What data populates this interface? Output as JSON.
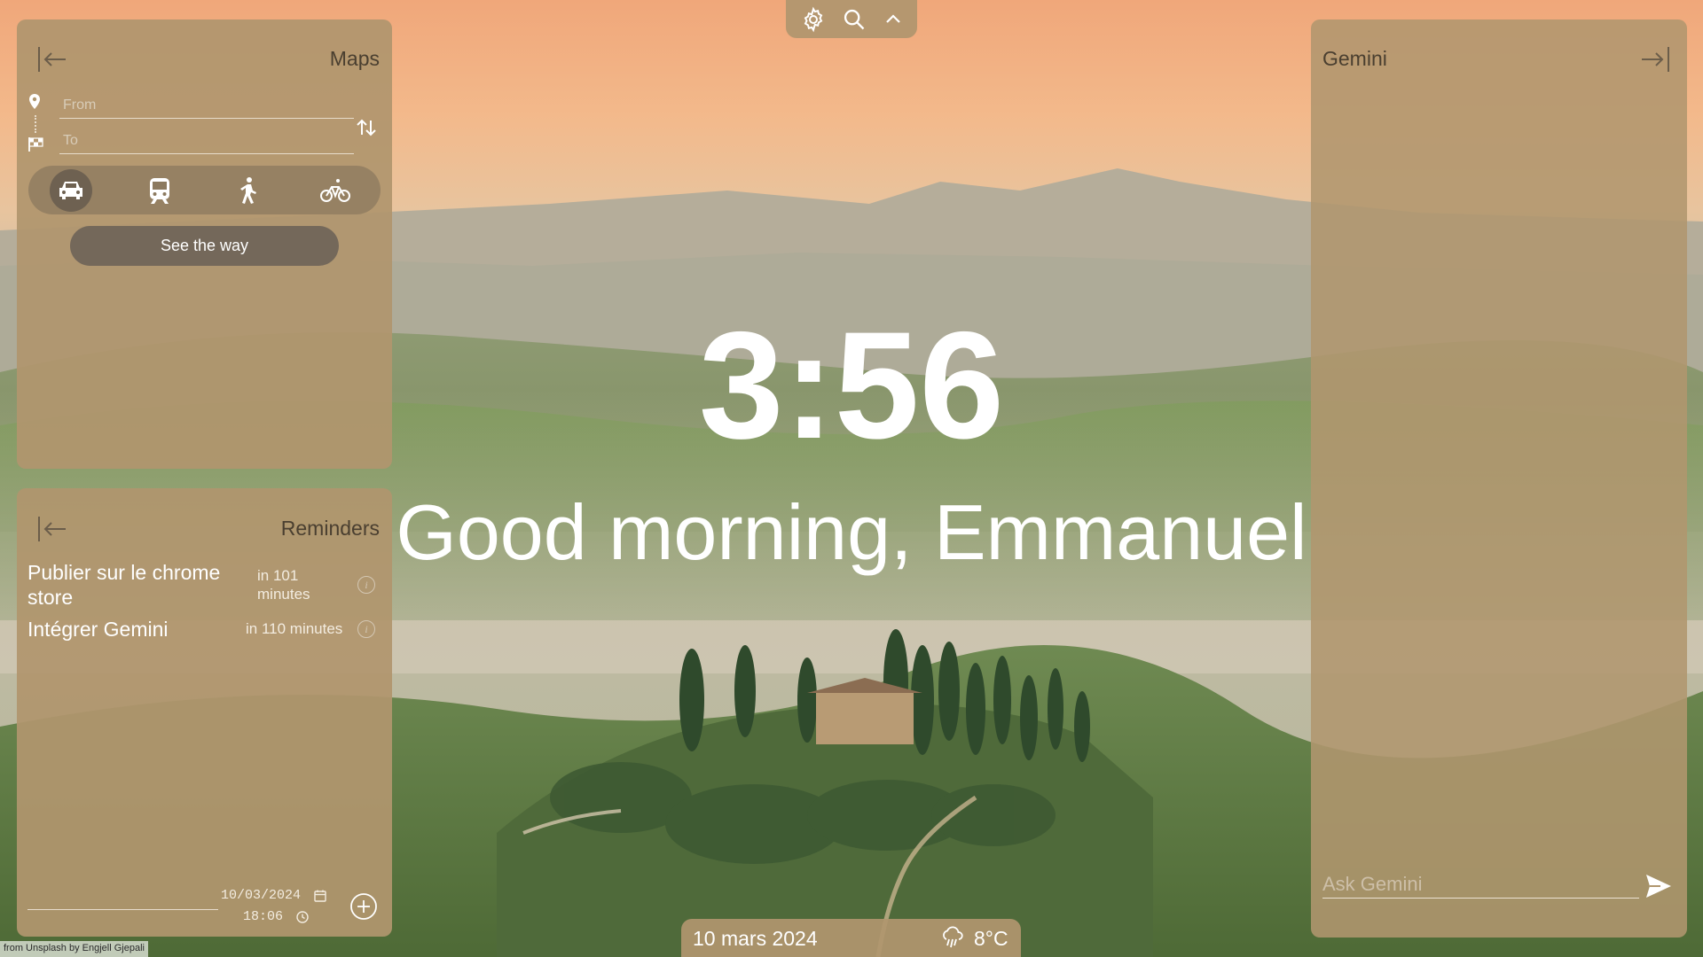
{
  "toolbar": {
    "settings_icon": "gear-icon",
    "search_icon": "search-icon",
    "collapse_icon": "chevron-up-icon"
  },
  "clock": {
    "time": "3:56"
  },
  "greeting": {
    "text": "Good morning, Emmanuel"
  },
  "maps": {
    "title": "Maps",
    "collapse_icon": "arrow-left-bar-icon",
    "from_placeholder": "From",
    "to_placeholder": "To",
    "swap_icon": "swap-vertical-icon",
    "modes": [
      {
        "icon": "car-icon",
        "active": true
      },
      {
        "icon": "train-icon",
        "active": false
      },
      {
        "icon": "walk-icon",
        "active": false
      },
      {
        "icon": "bike-icon",
        "active": false
      }
    ],
    "see_way_label": "See the way"
  },
  "reminders": {
    "title": "Reminders",
    "collapse_icon": "arrow-left-bar-icon",
    "items": [
      {
        "text": "Publier sur le chrome store",
        "when": "in 101 minutes"
      },
      {
        "text": "Intégrer Gemini",
        "when": "in 110 minutes"
      }
    ],
    "new_date": "10/03/2024",
    "new_time": "18:06",
    "add_icon": "plus-circle-icon"
  },
  "gemini": {
    "title": "Gemini",
    "collapse_icon": "arrow-right-bar-icon",
    "ask_placeholder": "Ask Gemini",
    "send_icon": "send-icon"
  },
  "statusbar": {
    "date": "10 mars 2024",
    "weather_icon": "rain-cloud-icon",
    "temperature": "8°C"
  },
  "credit": {
    "text": "from Unsplash by Engjell Gjepali"
  },
  "colors": {
    "panel": "#b0966e",
    "active_mode": "#6e6151",
    "button": "#74685a",
    "text_light": "#ffffff",
    "text_dark": "#4a3f30"
  }
}
